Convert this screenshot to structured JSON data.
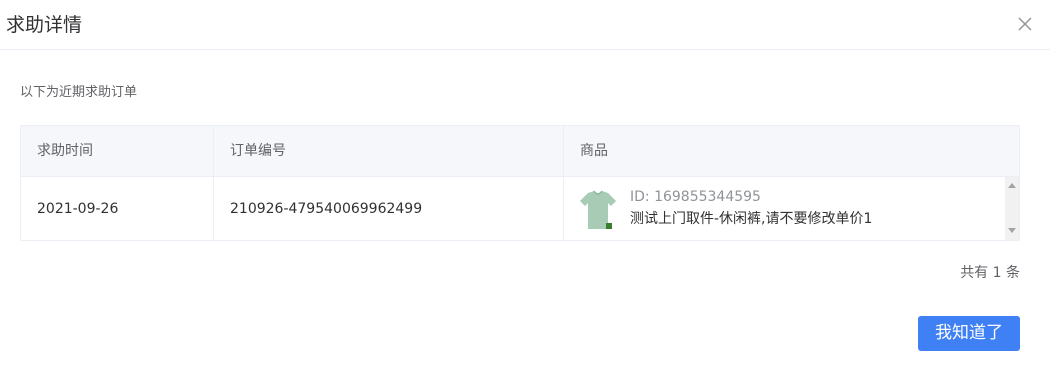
{
  "dialog": {
    "title": "求助详情",
    "intro": "以下为近期求助订单"
  },
  "table": {
    "columns": [
      "求助时间",
      "订单编号",
      "商品"
    ],
    "rows": [
      {
        "date": "2021-09-26",
        "order_no": "210926-479540069962499",
        "product_id": "ID: 169855344595",
        "product_name": "测试上门取件-休闲裤,请不要修改单价1"
      }
    ]
  },
  "footer": {
    "total": "共有 1 条",
    "confirm_label": "我知道了"
  },
  "colors": {
    "primary": "#4080f5",
    "header_bg": "#f5f7fa",
    "border": "#ebeef5"
  }
}
